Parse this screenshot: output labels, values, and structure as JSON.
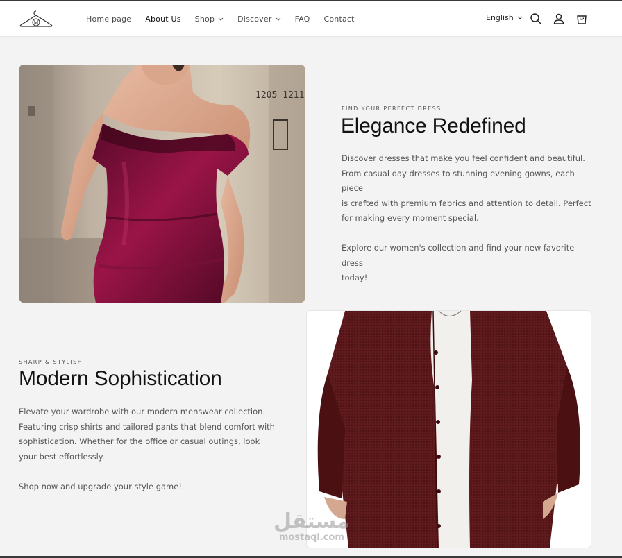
{
  "header": {
    "nav": [
      {
        "label": "Home page",
        "dropdown": false
      },
      {
        "label": "About Us",
        "dropdown": false,
        "active": true
      },
      {
        "label": "Shop",
        "dropdown": true
      },
      {
        "label": "Discover",
        "dropdown": true
      },
      {
        "label": "FAQ",
        "dropdown": false
      },
      {
        "label": "Contact",
        "dropdown": false
      }
    ],
    "language": "English",
    "icons": [
      "search-icon",
      "account-icon",
      "cart-icon"
    ]
  },
  "section1": {
    "eyebrow": "FIND YOUR PERFECT DRESS",
    "heading": "Elegance Redefined",
    "paragraph1_lines": [
      "Discover dresses that make you feel confident and beautiful.",
      "From casual day dresses to stunning evening gowns, each piece",
      "is crafted with premium fabrics and attention to detail. Perfect",
      "for making every moment special."
    ],
    "paragraph2_lines": [
      "Explore our women's collection and find your new favorite dress",
      "today!"
    ]
  },
  "section2": {
    "eyebrow": "SHARP & STYLISH",
    "heading": "Modern Sophistication",
    "paragraph1_lines": [
      "Elevate your wardrobe with our modern menswear collection.",
      "Featuring crisp shirts and tailored pants that blend comfort with",
      "sophistication. Whether for the office or casual outings, look",
      "your best effortlessly."
    ],
    "paragraph2_lines": [
      "Shop now and upgrade your style game!"
    ]
  },
  "watermark": {
    "arabic": "مستقل",
    "latin": "mostaql.com"
  }
}
